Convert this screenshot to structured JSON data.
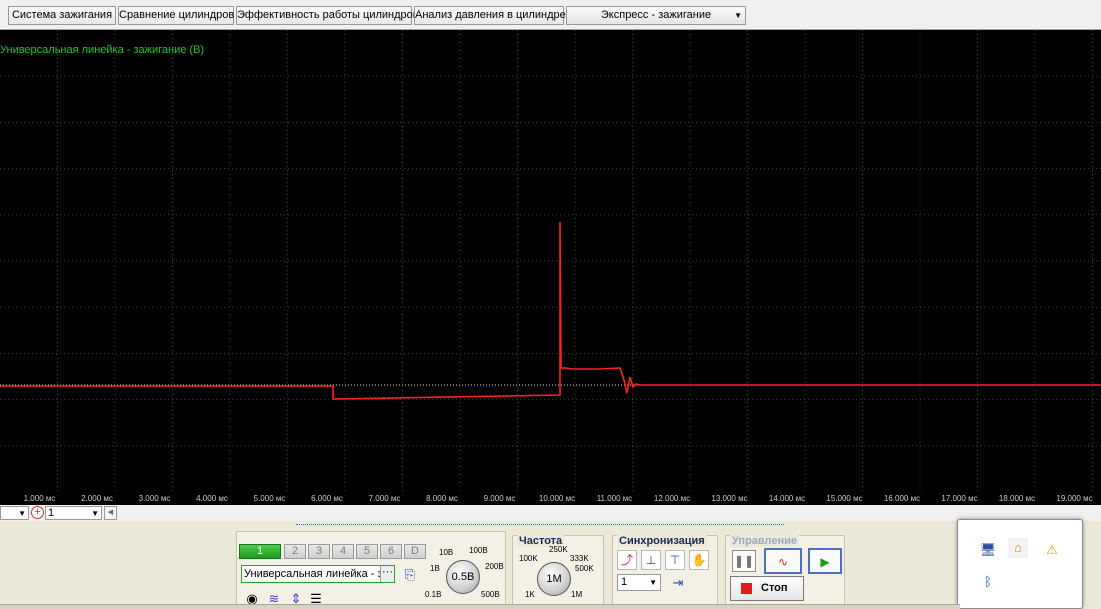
{
  "tabs": [
    {
      "label": "Система зажигания"
    },
    {
      "label": "Сравнение цилиндров"
    },
    {
      "label": "Эффективность работы цилиндров"
    },
    {
      "label": "Анализ давления в цилиндре"
    }
  ],
  "mode_select": {
    "value": "Экспресс - зажигание"
  },
  "scope": {
    "title": "Универсальная линейка - зажигание (В)",
    "trace_color": "#ff2020",
    "title_color": "#23c423",
    "time_ticks": [
      "1.000 мс",
      "2.000 мс",
      "3.000 мс",
      "4.000 мс",
      "5.000 мс",
      "6.000 мс",
      "7.000 мс",
      "8.000 мс",
      "9.000 мс",
      "10.000 мс",
      "11.000 мс",
      "12.000 мс",
      "13.000 мс",
      "14.000 мс",
      "15.000 мс",
      "16.000 мс",
      "17.000 мс",
      "18.000 мс",
      "19.000 мс"
    ]
  },
  "channel_row": {
    "dropdown_value": "1"
  },
  "channels": {
    "buttons": [
      "1",
      "2",
      "3",
      "4",
      "5",
      "6",
      "D"
    ],
    "active": "1",
    "name_value": "Универсальная линейка - заж"
  },
  "voltage": {
    "knob_value": "0.5В",
    "labels": [
      "10В",
      "100В",
      "1В",
      "200В",
      "0.1В",
      "500В"
    ]
  },
  "frequency": {
    "title": "Частота",
    "knob_value": "1M",
    "labels": [
      "250K",
      "100K",
      "333K",
      "500K",
      "1K",
      "1M"
    ]
  },
  "sync": {
    "title": "Синхронизация",
    "dropdown_value": "1"
  },
  "control": {
    "title": "Управление",
    "stop_label": "Стоп",
    "stop_color": "#e21b1b"
  }
}
